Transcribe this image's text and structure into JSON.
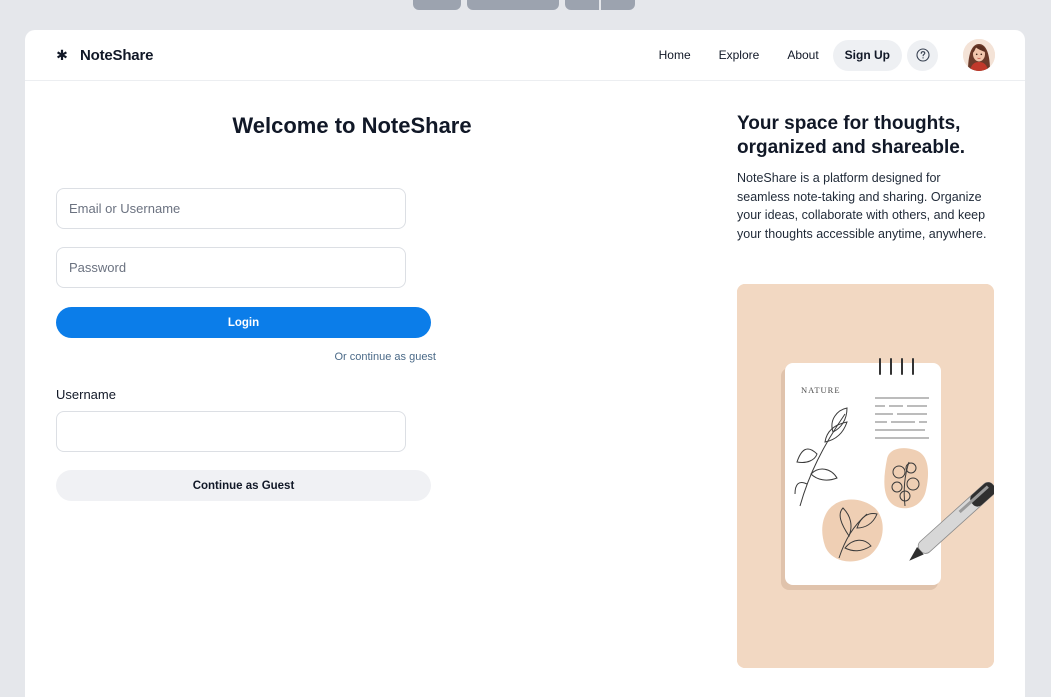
{
  "brand": {
    "icon": "asterisk-icon",
    "name": "NoteShare"
  },
  "nav": {
    "links": [
      "Home",
      "Explore",
      "About"
    ],
    "signup_label": "Sign Up",
    "help_icon": "help-circle-icon",
    "avatar": "user-avatar"
  },
  "login": {
    "title": "Welcome to NoteShare",
    "email_placeholder": "Email or Username",
    "password_placeholder": "Password",
    "login_label": "Login",
    "guest_link": "Or continue as guest",
    "username_label": "Username",
    "username_value": "",
    "guest_button_label": "Continue as Guest"
  },
  "info": {
    "title": "Your space for thoughts, organized and shareable.",
    "description": "NoteShare is a platform designed for seamless note-taking and sharing. Organize your ideas, collaborate with others, and keep your thoughts accessible anytime, anywhere.",
    "illustration_text": "NATURE"
  },
  "colors": {
    "accent": "#0b7de9",
    "background": "#e5e7eb",
    "illustration_bg": "#f2d8c2"
  }
}
